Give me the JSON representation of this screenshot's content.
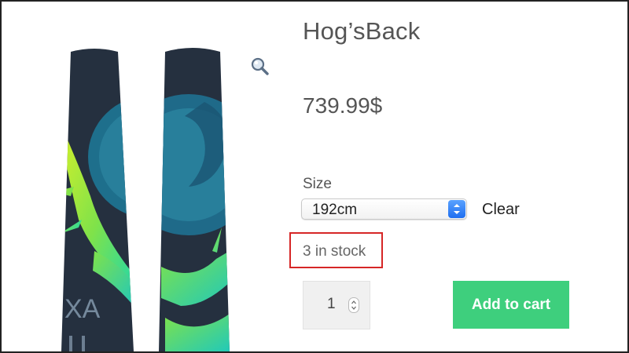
{
  "product": {
    "title": "Hog’sBack",
    "price_whole": "739",
    "price_decimal": ".99",
    "currency": "$"
  },
  "variations": {
    "size_label": "Size",
    "size_selected": "192cm",
    "clear_label": "Clear"
  },
  "stock": {
    "text": "3 in stock"
  },
  "cart": {
    "quantity": "1",
    "add_label": "Add to cart"
  },
  "icons": {
    "zoom": "magnifier-icon",
    "select_arrows": "select-arrows-icon",
    "quantity_stepper": "stepper-icon"
  },
  "colors": {
    "stock_highlight": "#d62626",
    "add_to_cart": "#3ecf7d",
    "select_spinner": "#1f6ff0"
  }
}
